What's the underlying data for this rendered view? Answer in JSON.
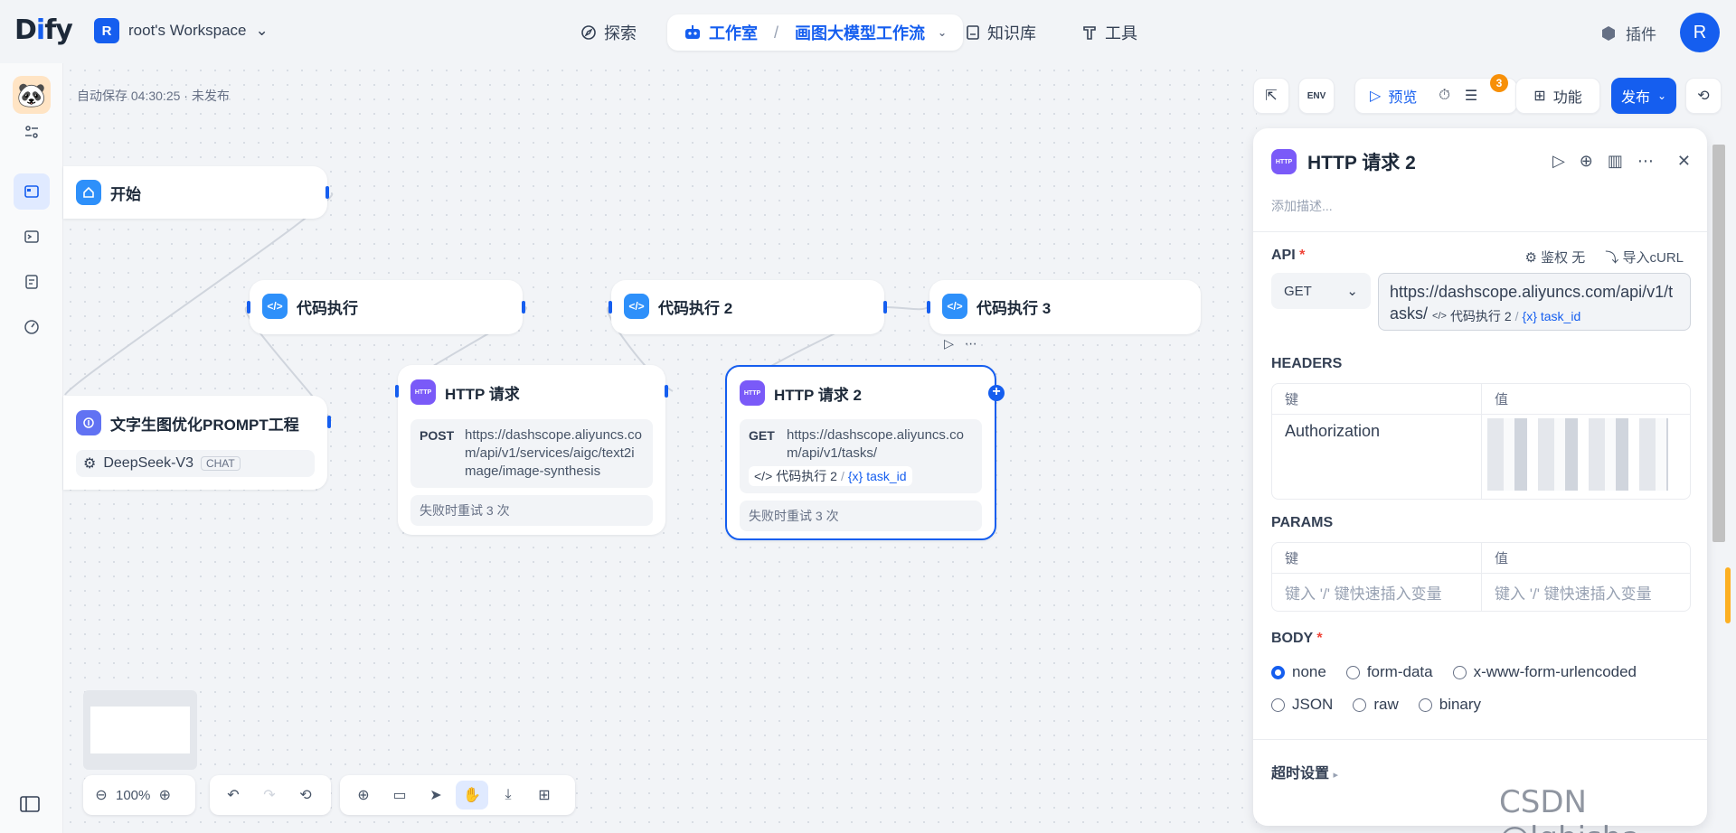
{
  "topbar": {
    "logo_prefix": "D",
    "logo_i": "i",
    "logo_suffix": "fy",
    "workspace_initial": "R",
    "workspace_name": "root's Workspace",
    "nav_explore": "探索",
    "nav_studio": "工作室",
    "nav_studio_separator": "/",
    "nav_app_name": "画图大模型工作流",
    "nav_knowledge": "知识库",
    "nav_tools": "工具",
    "plugins_label": "插件",
    "user_initial": "R"
  },
  "canvas": {
    "autosave": "自动保存 04:30:25 · 未发布",
    "nodes": {
      "start": {
        "title": "开始"
      },
      "code1": {
        "title": "代码执行"
      },
      "code2": {
        "title": "代码执行 2"
      },
      "code3": {
        "title": "代码执行 3"
      },
      "llm": {
        "title": "文字生图优化PROMPT工程",
        "model": "DeepSeek-V3",
        "mode": "CHAT"
      },
      "http1": {
        "title": "HTTP 请求",
        "method": "POST",
        "url": "https://dashscope.aliyuncs.com/api/v1/services/aigc/text2image/image-synthesis",
        "retry": "失败时重试 3 次"
      },
      "http2": {
        "title": "HTTP 请求 2",
        "method": "GET",
        "url": "https://dashscope.aliyuncs.com/api/v1/tasks/",
        "var_node": "代码执行 2",
        "var_sep": "/",
        "var_prefix": "{x}",
        "var_name": "task_id",
        "retry": "失败时重试 3 次"
      }
    },
    "zoom": "100%",
    "http_icon_text": "HTTP"
  },
  "actions": {
    "preview": "预览",
    "features": "功能",
    "publish": "发布",
    "env": "ENV",
    "checklist_count": "3"
  },
  "panel": {
    "title": "HTTP 请求 2",
    "description_placeholder": "添加描述...",
    "api_label": "API",
    "required_mark": "*",
    "auth_label": "鉴权 无",
    "import_curl": "导入cURL",
    "method": "GET",
    "url_text": "https://dashscope.aliyuncs.com/api/v1/tasks/",
    "url_var_node": "代码执行 2",
    "url_var_sep": "/",
    "url_var_prefix": "{x}",
    "url_var_name": "task_id",
    "headers_label": "HEADERS",
    "params_label": "PARAMS",
    "key_header": "键",
    "value_header": "值",
    "header_key": "Authorization",
    "param_key_placeholder": "键入 '/' 键快速插入变量",
    "param_value_placeholder": "键入 '/' 键快速插入变量",
    "body_label": "BODY",
    "body_options": [
      "none",
      "form-data",
      "x-www-form-urlencoded",
      "JSON",
      "raw",
      "binary"
    ],
    "body_selected": "none",
    "timeout_label": "超时设置"
  },
  "watermark": "CSDN @lgbisha",
  "colors": {
    "accent": "#155eef",
    "http": "#7a5af8",
    "code": "#2e90fa",
    "badge": "#f79009"
  }
}
